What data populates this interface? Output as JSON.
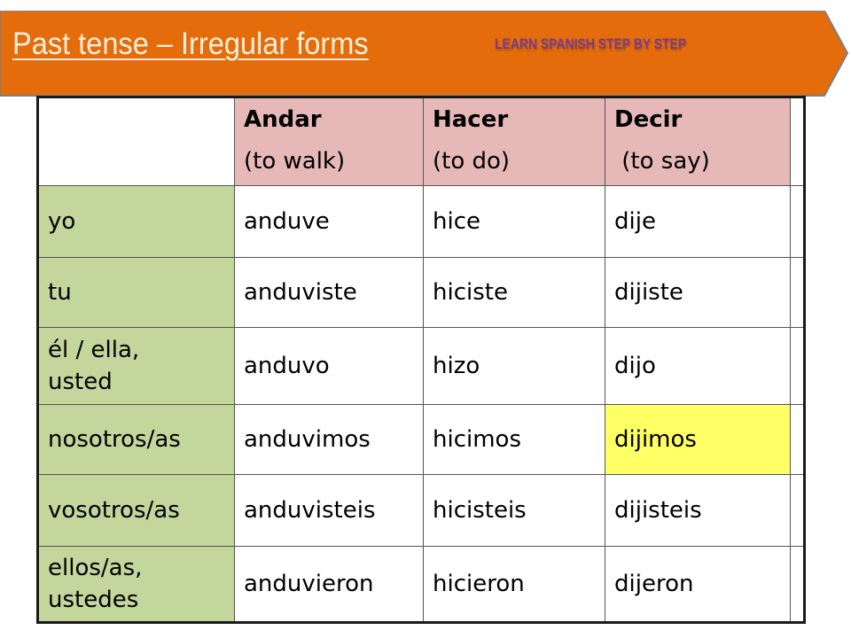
{
  "banner": {
    "title": "Past tense – Irregular forms",
    "subtitle": "LEARN SPANISH STEP BY STEP",
    "colors": {
      "fill": "#e46c0a",
      "title": "#fdf0dc",
      "subtitle": "#7a3b8f"
    }
  },
  "table": {
    "header": [
      {
        "verb": "",
        "gloss": ""
      },
      {
        "verb": "Andar",
        "gloss": "(to walk)"
      },
      {
        "verb": "Hacer",
        "gloss": "(to do)"
      },
      {
        "verb": "Decir",
        "gloss": " (to say)"
      }
    ],
    "rows": [
      {
        "pronoun": [
          "yo"
        ],
        "forms": [
          "anduve",
          "hice",
          "dije"
        ]
      },
      {
        "pronoun": [
          "tu"
        ],
        "forms": [
          "anduviste",
          "hiciste",
          "dijiste"
        ]
      },
      {
        "pronoun": [
          "él / ella,",
          "usted"
        ],
        "forms": [
          "anduvo",
          "hizo",
          "dijo"
        ]
      },
      {
        "pronoun": [
          "nosotros/as"
        ],
        "forms": [
          "anduvimos",
          "hicimos",
          "dijimos"
        ]
      },
      {
        "pronoun": [
          "vosotros/as"
        ],
        "forms": [
          "anduvisteis",
          "hicisteis",
          "dijisteis"
        ]
      },
      {
        "pronoun": [
          "ellos/as,",
          "ustedes"
        ],
        "forms": [
          "anduvieron",
          "hicieron",
          "dijeron"
        ]
      }
    ],
    "highlighted_cell": "dijimos",
    "colors": {
      "header": "#e6b9b8",
      "pronoun_column": "#c3d69b",
      "highlight": "#ffff66"
    }
  }
}
